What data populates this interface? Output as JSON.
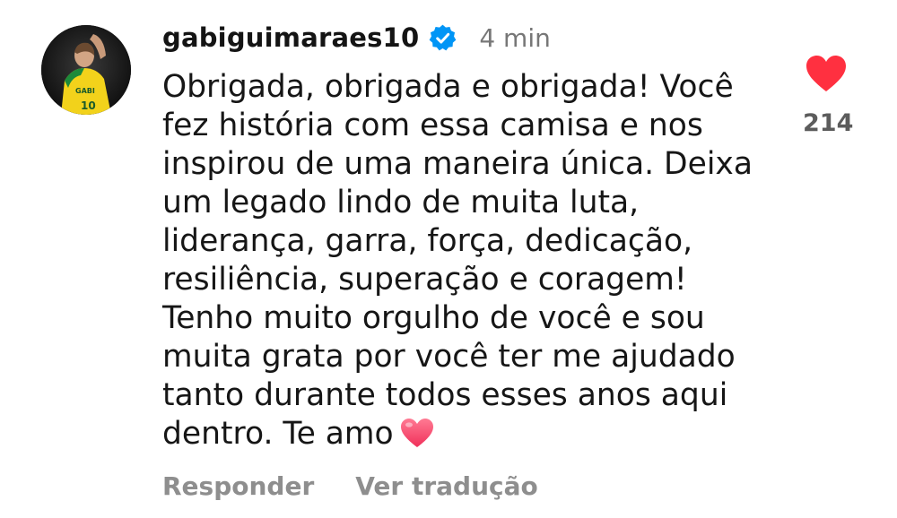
{
  "comment": {
    "username": "gabiguimaraes10",
    "verified_icon": "verified-badge-icon",
    "timestamp": "4 min",
    "text": "Obrigada, obrigada e obrigada! Você\nfez história com essa camisa e nos\ninspirou de uma maneira única. Deixa\num legado lindo de muita luta,\nliderança, garra, força, dedicação,\nresiliência, superação e coragem!\nTenho muito orgulho de você e sou\nmuita grata por você ter me ajudado\ntanto durante todos esses anos aqui\ndentro. Te amo",
    "trailing_emoji": "heart-emoji-icon"
  },
  "like": {
    "icon": "heart-icon",
    "count": "214",
    "liked": true,
    "color": "#ff3040"
  },
  "actions": {
    "reply_label": "Responder",
    "translate_label": "Ver tradução"
  },
  "colors": {
    "verified": "#0095f6",
    "muted_text": "#8e8e8e"
  }
}
